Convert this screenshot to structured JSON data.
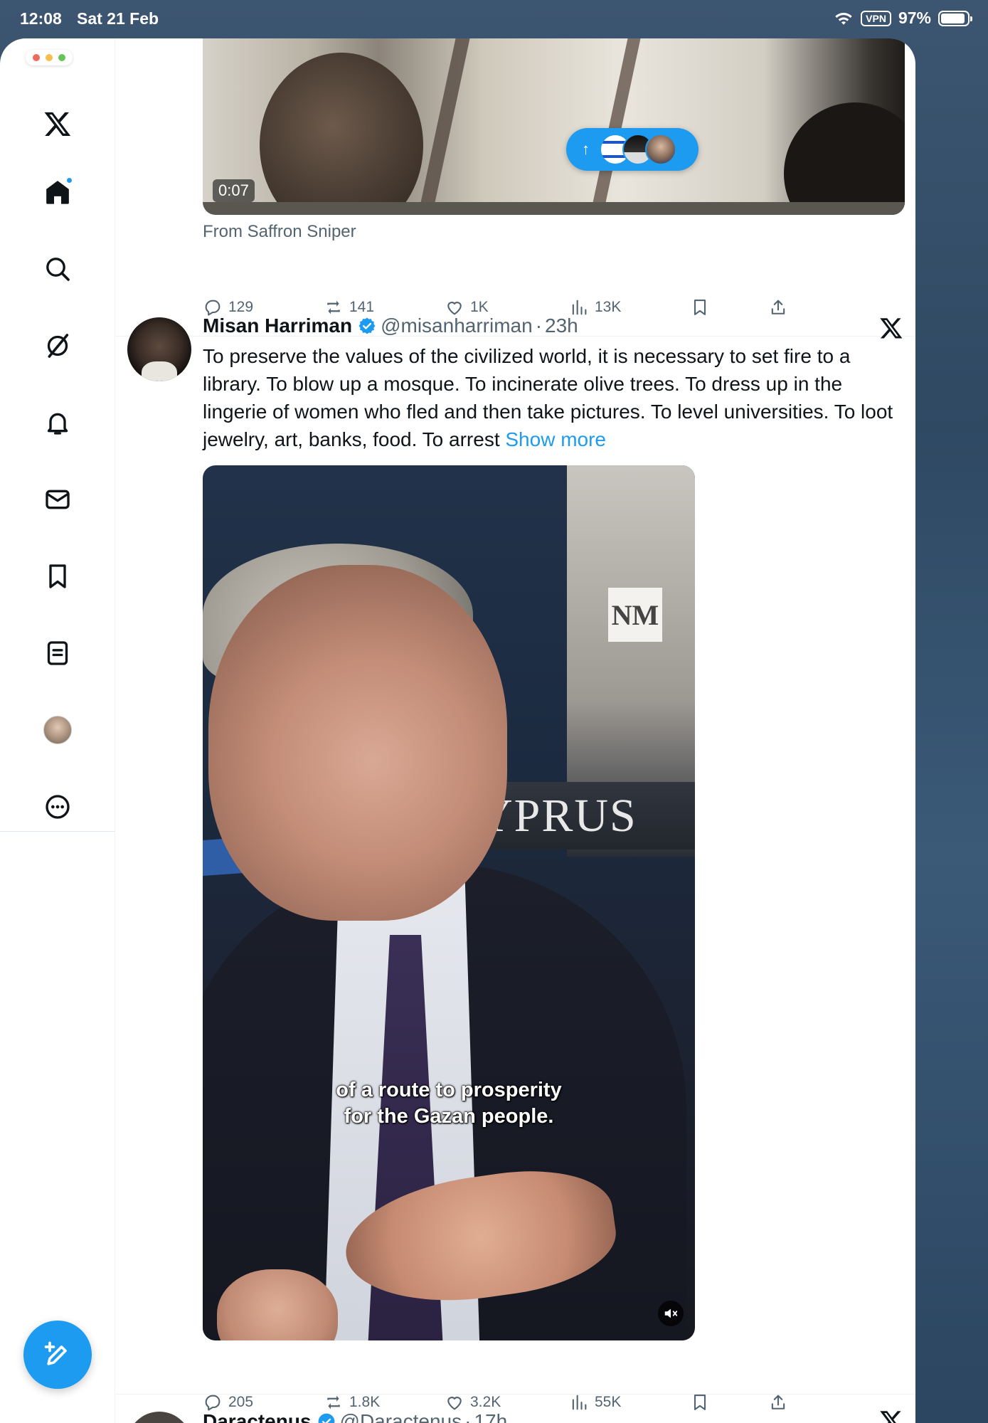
{
  "status_bar": {
    "time": "12:08",
    "date": "Sat 21 Feb",
    "vpn": "VPN",
    "battery": "97%"
  },
  "sidebar": {
    "items": [
      {
        "icon": "x-logo-icon"
      },
      {
        "icon": "home-icon",
        "has_notification": true
      },
      {
        "icon": "search-icon"
      },
      {
        "icon": "grok-icon"
      },
      {
        "icon": "bell-icon"
      },
      {
        "icon": "mail-icon"
      },
      {
        "icon": "bookmark-icon"
      },
      {
        "icon": "lists-icon"
      },
      {
        "icon": "profile-avatar"
      },
      {
        "icon": "more-icon"
      }
    ],
    "compose_icon": "compose-icon"
  },
  "previous_post": {
    "video_duration": "0:07",
    "source": "From Saffron Sniper",
    "stats": {
      "replies": "129",
      "reposts": "141",
      "likes": "1K",
      "views": "13K"
    }
  },
  "new_posts_pill": {
    "arrow": "↑"
  },
  "post": {
    "name": "Misan Harriman",
    "handle": "@misanharriman",
    "separator": "·",
    "time": "23h",
    "text": "To preserve the values of the civilized world, it is necessary to set fire to a library. To blow up a mosque. To incinerate olive trees. To dress up in the lingerie of women who fled and then take pictures. To level universities. To loot jewelry, art, banks, food. To arrest",
    "show_more": "Show more",
    "video": {
      "watermark": "NM",
      "sign_text": "YPRUS",
      "caption_line1": "of a route to prosperity",
      "caption_line2": "for the Gazan people."
    },
    "stats": {
      "replies": "205",
      "reposts": "1.8K",
      "likes": "3.2K",
      "views": "55K"
    }
  },
  "next_post": {
    "name": "Daractenus",
    "handle": "@Daractenus",
    "separator": "·",
    "time": "17h"
  },
  "colors": {
    "accent": "#1d9bf0",
    "text": "#0f1419",
    "secondary": "#536471"
  }
}
